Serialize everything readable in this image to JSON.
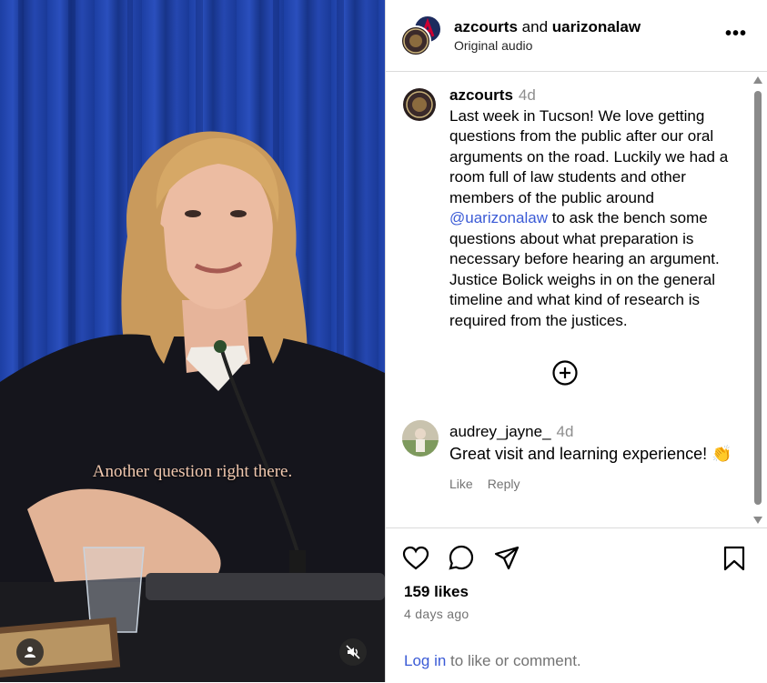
{
  "video": {
    "caption": "Another question right there."
  },
  "header": {
    "account1": "azcourts",
    "joiner": "and",
    "account2": "uarizonalaw",
    "audio": "Original audio"
  },
  "post": {
    "username": "azcourts",
    "time": "4d",
    "text_before": "Last week in Tucson! We love getting questions from the public after our oral arguments on the road. Luckily we had a room full of law students and other members of the public around ",
    "mention": "@uarizonalaw",
    "text_after": " to ask the bench some questions about what preparation is necessary before hearing an argument. Justice Bolick weighs in on the general timeline and what kind of research is required from the justices."
  },
  "comment": {
    "username": "audrey_jayne_",
    "time": "4d",
    "text": "Great visit and learning experience! 👏",
    "like_label": "Like",
    "reply_label": "Reply"
  },
  "stats": {
    "likes": "159 likes",
    "posted": "4 days ago"
  },
  "footer": {
    "login_link": "Log in",
    "login_rest": " to like or comment."
  }
}
